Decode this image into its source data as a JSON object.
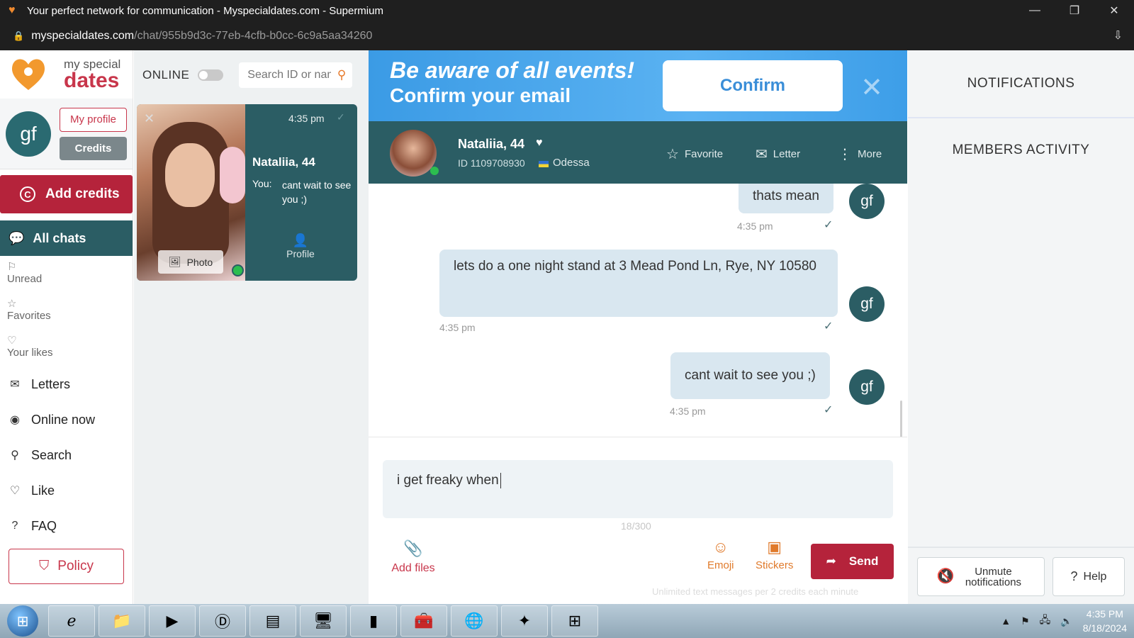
{
  "window": {
    "title": "Your perfect network for communication - Myspecialdates.com - Supermium",
    "url_domain": "myspecialdates.com",
    "url_path": "/chat/955b9d3c-77eb-4cfb-b0cc-6c9a5aa34260"
  },
  "brand": {
    "line1": "my special",
    "line2": "dates"
  },
  "user": {
    "initials": "gf",
    "my_profile_label": "My profile",
    "credits_label": "Credits",
    "add_credits_label": "Add credits"
  },
  "nav": {
    "all_chats": "All chats",
    "unread": "Unread",
    "favorites": "Favorites",
    "your_likes": "Your likes",
    "letters": "Letters",
    "online_now": "Online now",
    "search": "Search",
    "like": "Like",
    "faq": "FAQ",
    "policy": "Policy"
  },
  "chatlist": {
    "online_label": "ONLINE",
    "online_toggle": "off",
    "search_placeholder": "Search ID or name",
    "card": {
      "time": "4:35 pm",
      "name": "Nataliia, 44",
      "you_label": "You:",
      "last_message": "cant wait to see you ;)",
      "photo_label": "Photo",
      "profile_label": "Profile"
    }
  },
  "banner": {
    "line1": "Be aware of all events!",
    "line2": "Confirm your email",
    "confirm_label": "Confirm"
  },
  "chat_header": {
    "name": "Nataliia, 44",
    "id": "ID 1109708930",
    "city": "Odessa",
    "favorite_label": "Favorite",
    "letter_label": "Letter",
    "more_label": "More"
  },
  "messages": [
    {
      "text": "thats mean",
      "time": "4:35 pm"
    },
    {
      "text": "lets do a one night stand at 3 Mead Pond Ln, Rye, NY 10580",
      "time": "4:35 pm"
    },
    {
      "text": "cant wait to see you ;)",
      "time": "4:35 pm"
    }
  ],
  "composer": {
    "text": "i get freaky when",
    "counter": "18/300",
    "add_files_label": "Add files",
    "emoji_label": "Emoji",
    "stickers_label": "Stickers",
    "send_label": "Send",
    "footnote": "Unlimited text messages per 2 credits each minute"
  },
  "right_panel": {
    "notifications_title": "NOTIFICATIONS",
    "members_activity_title": "MEMBERS ACTIVITY",
    "unmute_label": "Unmute notifications",
    "help_label": "Help"
  },
  "taskbar": {
    "time": "4:35 PM",
    "date": "8/18/2024"
  },
  "colors": {
    "brand_red": "#b5233b",
    "teal": "#2b5d64",
    "banner_blue": "#3b9be5",
    "accent_orange": "#e07a2b"
  }
}
